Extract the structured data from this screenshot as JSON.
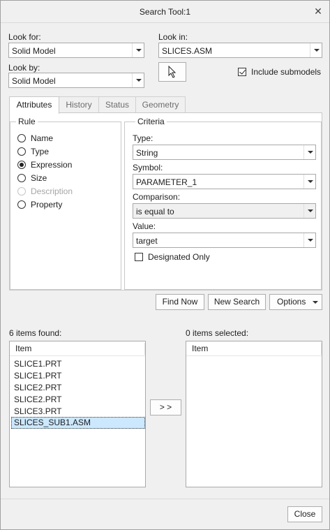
{
  "window": {
    "title": "Search Tool:1"
  },
  "look_for": {
    "label": "Look for:",
    "value": "Solid Model"
  },
  "look_in": {
    "label": "Look in:",
    "value": "SLICES.ASM"
  },
  "look_by": {
    "label": "Look by:",
    "value": "Solid Model"
  },
  "include_submodels": {
    "label": "Include submodels",
    "checked": true
  },
  "tabs": [
    {
      "label": "Attributes",
      "active": true
    },
    {
      "label": "History",
      "active": false
    },
    {
      "label": "Status",
      "active": false
    },
    {
      "label": "Geometry",
      "active": false
    }
  ],
  "rule": {
    "title": "Rule",
    "options": [
      {
        "label": "Name",
        "checked": false,
        "disabled": false
      },
      {
        "label": "Type",
        "checked": false,
        "disabled": false
      },
      {
        "label": "Expression",
        "checked": true,
        "disabled": false
      },
      {
        "label": "Size",
        "checked": false,
        "disabled": false
      },
      {
        "label": "Description",
        "checked": false,
        "disabled": true
      },
      {
        "label": "Property",
        "checked": false,
        "disabled": false
      }
    ]
  },
  "criteria": {
    "title": "Criteria",
    "type_label": "Type:",
    "type_value": "String",
    "symbol_label": "Symbol:",
    "symbol_value": "PARAMETER_1",
    "comparison_label": "Comparison:",
    "comparison_value": "is equal to",
    "value_label": "Value:",
    "value_value": "target",
    "designated_only": {
      "label": "Designated Only",
      "checked": false
    }
  },
  "actions": {
    "find_now": "Find Now",
    "new_search": "New Search",
    "options": "Options"
  },
  "found": {
    "count_label": "6 items found:",
    "column": "Item",
    "items": [
      "SLICE1.PRT",
      "SLICE1.PRT",
      "SLICE2.PRT",
      "SLICE2.PRT",
      "SLICE3.PRT",
      "SLICES_SUB1.ASM"
    ],
    "selected_index": 5
  },
  "transfer_button": "> >",
  "selected": {
    "count_label": "0 items selected:",
    "column": "Item"
  },
  "close_button": "Close",
  "colors": {
    "selection": "#cce8ff",
    "background": "#f0f0f0"
  }
}
